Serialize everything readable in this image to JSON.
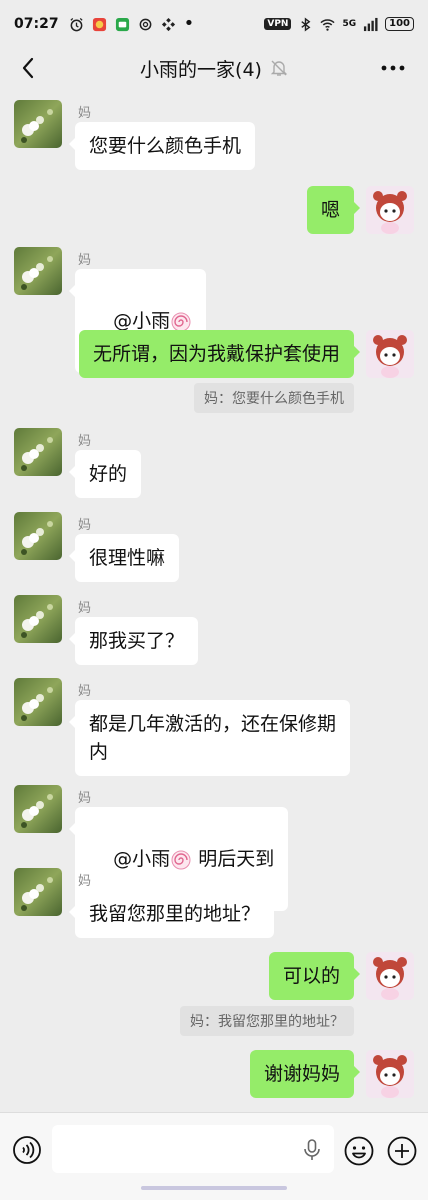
{
  "status_bar": {
    "time": "07:27",
    "vpn": "VPN",
    "network": "5G",
    "battery": "100"
  },
  "header": {
    "title": "小雨的一家(4)"
  },
  "messages": [
    {
      "side": "left",
      "sender": "妈",
      "text": "您要什么颜色手机"
    },
    {
      "side": "right",
      "text": "嗯"
    },
    {
      "side": "left",
      "sender": "妈",
      "text": "@小雨",
      "emoji": "swirl"
    },
    {
      "side": "right",
      "text": "无所谓，因为我戴保护套使用",
      "quote": "妈：您要什么颜色手机"
    },
    {
      "side": "left",
      "sender": "妈",
      "text": "好的"
    },
    {
      "side": "left",
      "sender": "妈",
      "text": "很理性嘛"
    },
    {
      "side": "left",
      "sender": "妈",
      "text": "那我买了？"
    },
    {
      "side": "left",
      "sender": "妈",
      "text": "都是几年激活的，还在保修期\n内"
    },
    {
      "side": "left",
      "sender": "妈",
      "text": "@小雨",
      "text_after": " 明后天到",
      "emoji": "swirl"
    },
    {
      "side": "left",
      "sender": "妈",
      "text": "我留您那里的地址？"
    },
    {
      "side": "right",
      "text": "可以的",
      "quote": "妈：我留您那里的地址？"
    },
    {
      "side": "right",
      "text": "谢谢妈妈"
    }
  ],
  "colors": {
    "background": "#ededed",
    "my_bubble": "#95ec69",
    "their_bubble": "#ffffff"
  },
  "icons": [
    "back-icon",
    "mute-bell-icon",
    "more-icon",
    "voice-icon",
    "mic-icon",
    "emoji-icon",
    "plus-icon"
  ]
}
